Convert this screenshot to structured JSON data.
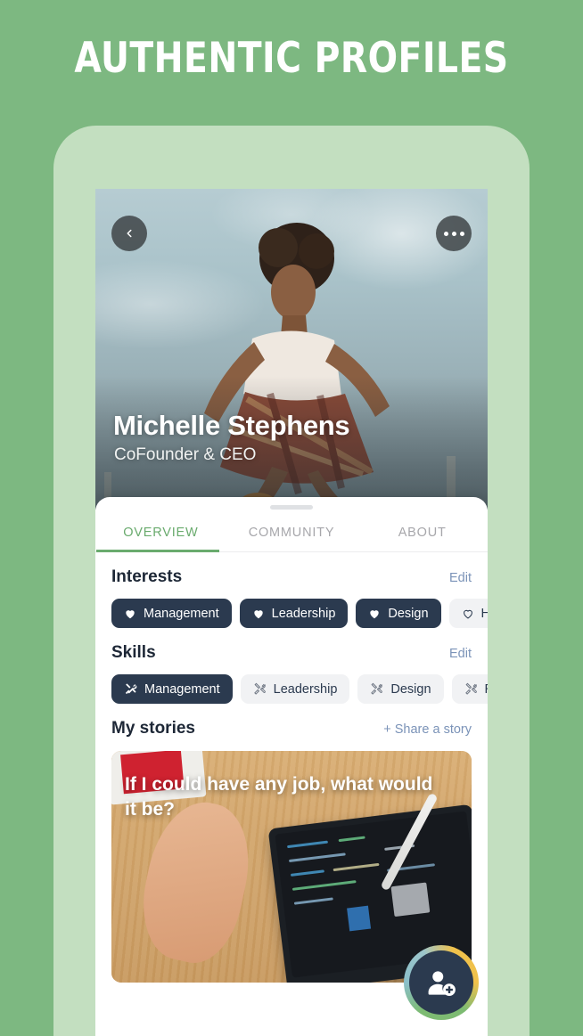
{
  "headline": "AUTHENTIC PROFILES",
  "colors": {
    "background_green": "#7db881",
    "phone_frame_green": "#c3dfc0",
    "accent_green": "#6aab6e",
    "chip_active_navy": "#2b3a4f",
    "chip_inactive_gray": "#f1f2f4",
    "link_blue": "#7b93b8"
  },
  "hero": {
    "back_icon": "chevron-left-icon",
    "more_icon": "more-horizontal-icon",
    "name": "Michelle Stephens",
    "role": "CoFounder & CEO"
  },
  "tabs": [
    {
      "label": "OVERVIEW",
      "active": true
    },
    {
      "label": "COMMUNITY",
      "active": false
    },
    {
      "label": "ABOUT",
      "active": false
    }
  ],
  "interests": {
    "title": "Interests",
    "edit_label": "Edit",
    "chips": [
      {
        "label": "Management",
        "selected": true,
        "icon": "heart-filled-icon"
      },
      {
        "label": "Leadership",
        "selected": true,
        "icon": "heart-filled-icon"
      },
      {
        "label": "Design",
        "selected": true,
        "icon": "heart-filled-icon"
      },
      {
        "label": "Ho",
        "selected": false,
        "icon": "heart-outline-icon"
      }
    ]
  },
  "skills": {
    "title": "Skills",
    "edit_label": "Edit",
    "chips": [
      {
        "label": "Management",
        "selected": true,
        "icon": "tools-icon"
      },
      {
        "label": "Leadership",
        "selected": false,
        "icon": "tools-icon"
      },
      {
        "label": "Design",
        "selected": false,
        "icon": "tools-icon"
      },
      {
        "label": "Ru",
        "selected": false,
        "icon": "tools-icon"
      }
    ]
  },
  "stories": {
    "title": "My stories",
    "share_label": "+ Share a story",
    "card_title": "If I could have any job, what would it be?"
  },
  "fab": {
    "icon": "add-person-icon"
  }
}
